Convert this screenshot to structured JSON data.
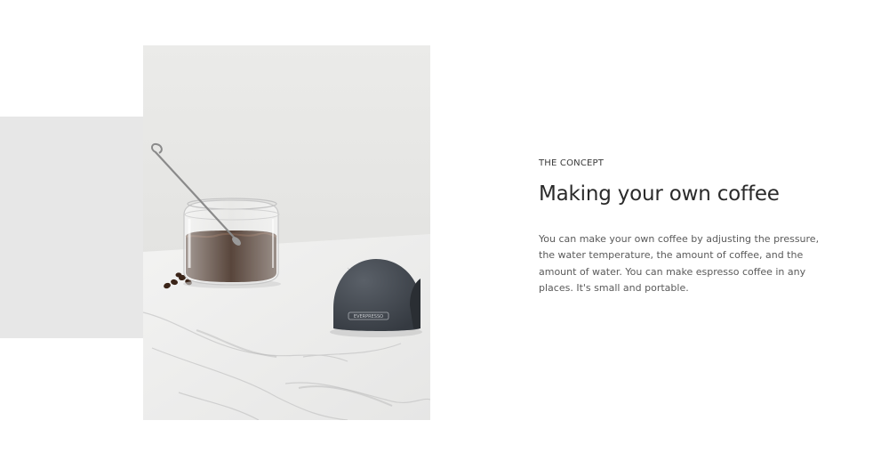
{
  "concept": {
    "eyebrow": "THE CONCEPT",
    "title": "Making your own coffee",
    "description": "You can make your own coffee by adjusting the pressure, the water temperature, the amount of coffee, and the amount of water. You can make espresso coffee in any places. It's small and portable."
  },
  "photo": {
    "device_label": "EVERPRESSO"
  },
  "colors": {
    "background": "#ffffff",
    "accent_block": "#e7e7e7",
    "title_text": "#2a2a2a",
    "body_text": "#5a5a5a"
  }
}
